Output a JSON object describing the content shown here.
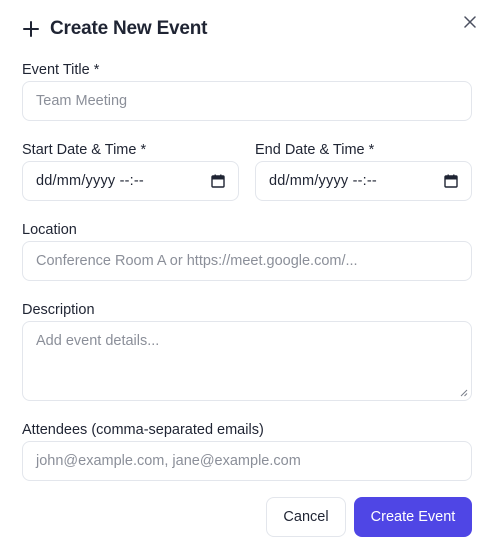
{
  "dialog": {
    "title": "Create New Event",
    "plus_icon": "plus-icon",
    "close_icon": "close-icon"
  },
  "form": {
    "event_title": {
      "label": "Event Title *",
      "placeholder": "Team Meeting"
    },
    "start": {
      "label": "Start Date & Time *",
      "value": "dd/mm/yyyy --:--",
      "icon": "calendar-icon"
    },
    "end": {
      "label": "End Date & Time *",
      "value": "dd/mm/yyyy --:--",
      "icon": "calendar-icon"
    },
    "location": {
      "label": "Location",
      "placeholder": "Conference Room A or https://meet.google.com/..."
    },
    "description": {
      "label": "Description",
      "placeholder": "Add event details..."
    },
    "attendees": {
      "label": "Attendees (comma-separated emails)",
      "placeholder": "john@example.com, jane@example.com"
    }
  },
  "actions": {
    "cancel_label": "Cancel",
    "create_label": "Create Event"
  },
  "colors": {
    "primary": "#4f46e5",
    "border": "#e3e6ec",
    "text": "#1f2433",
    "placeholder": "#8b8f99"
  }
}
